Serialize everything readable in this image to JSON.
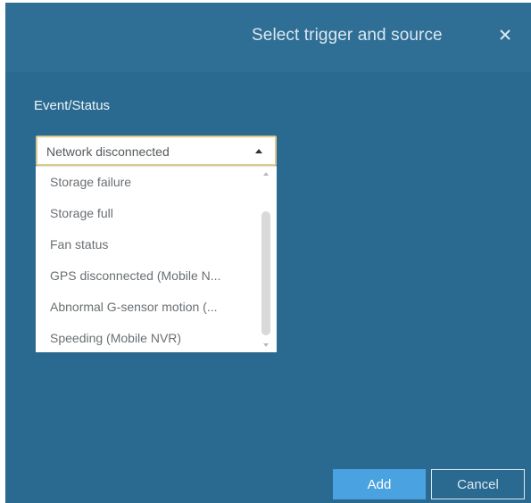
{
  "dialog": {
    "title": "Select trigger and source",
    "close_icon": "close-icon",
    "field_label": "Event/Status",
    "select": {
      "value": "Network disconnected",
      "options": [
        "Storage failure",
        "Storage full",
        "Fan status",
        "GPS disconnected (Mobile N...",
        "Abnormal G-sensor motion (...",
        "Speeding (Mobile NVR)"
      ]
    },
    "buttons": {
      "add": "Add",
      "cancel": "Cancel"
    }
  },
  "colors": {
    "background": "#2b6a90",
    "primary_button": "#4aa3e0",
    "select_border": "#d9c98c"
  }
}
